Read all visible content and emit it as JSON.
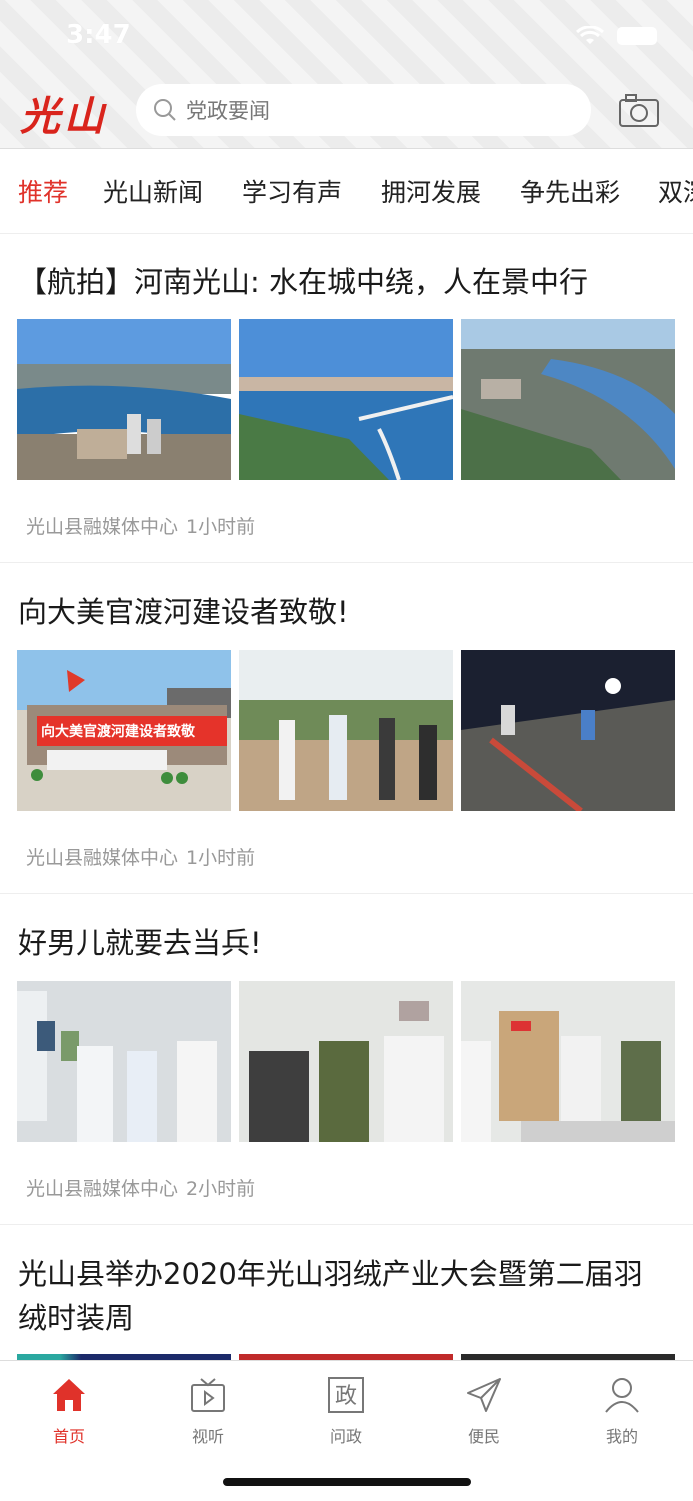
{
  "status": {
    "time": "3:47"
  },
  "header": {
    "logo": "光山",
    "search_placeholder": "党政要闻"
  },
  "tabs": [
    "推荐",
    "光山新闻",
    "学习有声",
    "拥河发展",
    "争先出彩",
    "双深"
  ],
  "articles": [
    {
      "title": "【航拍】河南光山: 水在城中绕，人在景中行",
      "source": "光山县融媒体中心",
      "time": "1小时前"
    },
    {
      "title": "向大美官渡河建设者致敬!",
      "source": "光山县融媒体中心",
      "time": "1小时前",
      "banner_text": "向大美官渡河建设者致敬"
    },
    {
      "title": "好男儿就要去当兵!",
      "source": "光山县融媒体中心",
      "time": "2小时前"
    },
    {
      "title": "光山县举办2020年光山羽绒产业大会暨第二届羽绒时装周"
    }
  ],
  "tabbar": [
    "首页",
    "视听",
    "问政",
    "便民",
    "我的"
  ],
  "colors": {
    "accent": "#e0322a",
    "logo": "#d9241c"
  }
}
